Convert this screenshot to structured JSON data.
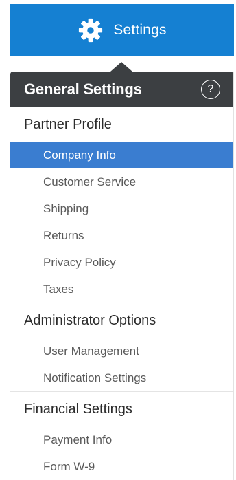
{
  "top_button": {
    "label": "Settings",
    "icon": "gear-icon"
  },
  "colors": {
    "accent": "#1580d2",
    "header": "#3c3f42",
    "active_item": "#3a7dd0"
  },
  "panel": {
    "title": "General Settings",
    "help_glyph": "?",
    "help_icon": "question-circle-icon"
  },
  "sections": [
    {
      "title": "Partner Profile",
      "items": [
        "Company Info",
        "Customer Service",
        "Shipping",
        "Returns",
        "Privacy Policy",
        "Taxes"
      ]
    },
    {
      "title": "Administrator Options",
      "items": [
        "User Management",
        "Notification Settings"
      ]
    },
    {
      "title": "Financial Settings",
      "items": [
        "Payment Info",
        "Form W-9"
      ]
    }
  ],
  "active_item": "Company Info"
}
